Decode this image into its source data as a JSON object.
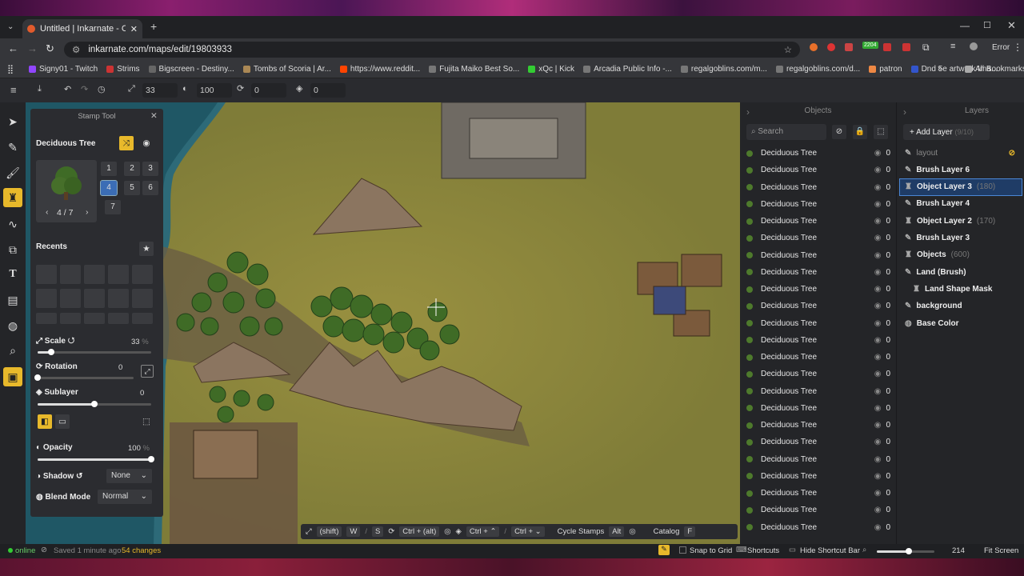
{
  "browser": {
    "tab_title": "Untitled | Inkarnate - Create Fa",
    "url": "inkarnate.com/maps/edit/19803933",
    "error_label": "Error",
    "bookmarks": [
      "Signy01 - Twitch",
      "Strims",
      "Bigscreen - Destiny...",
      "Tombs of Scoria | Ar...",
      "https://www.reddit...",
      "Fujita Maiko Best So...",
      "xQc | Kick",
      "Arcadia Public Info -...",
      "regalgoblins.com/m...",
      "regalgoblins.com/d...",
      "patron",
      "Dnd 5e artwork Ima..."
    ],
    "all_bookmarks": "All Bookmarks",
    "ext_badge": "2204"
  },
  "toolbar": {
    "scale_value": "33",
    "opacity_value": "100",
    "rotation_value": "0",
    "layer_value": "0"
  },
  "stamp": {
    "title": "Stamp Tool",
    "asset_name": "Deciduous Tree",
    "variant_counter": "4 / 7",
    "variants": [
      "1",
      "2",
      "3",
      "4",
      "5",
      "6",
      "7"
    ],
    "selected_variant": "4",
    "recents_label": "Recents",
    "scale_label": "Scale",
    "scale_value": "33",
    "scale_unit": "%",
    "scale_level": 0.12,
    "rotation_label": "Rotation",
    "rotation_value": "0",
    "rotation_level": 0.0,
    "sublayer_label": "Sublayer",
    "sublayer_value": "0",
    "sublayer_level": 0.5,
    "opacity_label": "Opacity",
    "opacity_value": "100",
    "opacity_unit": "%",
    "opacity_level": 1.0,
    "shadow_label": "Shadow",
    "shadow_value": "None",
    "blend_label": "Blend Mode",
    "blend_value": "Normal"
  },
  "objects": {
    "header": "Objects",
    "search_placeholder": "Search",
    "item_name": "Deciduous Tree",
    "item_count": "0",
    "items": [
      "Deciduous Tree",
      "Deciduous Tree",
      "Deciduous Tree",
      "Deciduous Tree",
      "Deciduous Tree",
      "Deciduous Tree",
      "Deciduous Tree",
      "Deciduous Tree",
      "Deciduous Tree",
      "Deciduous Tree",
      "Deciduous Tree",
      "Deciduous Tree",
      "Deciduous Tree",
      "Deciduous Tree",
      "Deciduous Tree",
      "Deciduous Tree",
      "Deciduous Tree",
      "Deciduous Tree",
      "Deciduous Tree",
      "Deciduous Tree",
      "Deciduous Tree",
      "Deciduous Tree",
      "Deciduous Tree"
    ]
  },
  "layers": {
    "header": "Layers",
    "add_label": "Add Layer",
    "add_count": "(9/10)",
    "items": [
      {
        "name": "layout",
        "count": "",
        "dim": true
      },
      {
        "name": "Brush Layer 6",
        "count": ""
      },
      {
        "name": "Object Layer 3",
        "count": "(180)",
        "selected": true
      },
      {
        "name": "Brush Layer 4",
        "count": ""
      },
      {
        "name": "Object Layer 2",
        "count": "(170)"
      },
      {
        "name": "Brush Layer 3",
        "count": ""
      },
      {
        "name": "Objects",
        "count": "(600)"
      },
      {
        "name": "Land (Brush)",
        "count": ""
      },
      {
        "name": "Land Shape Mask",
        "count": "",
        "sub": true
      },
      {
        "name": "background",
        "count": ""
      },
      {
        "name": "Base Color",
        "count": ""
      }
    ]
  },
  "shortcuts": {
    "shift": "(shift)",
    "w": "W",
    "s": "S",
    "ctrl_alt": "Ctrl + (alt)",
    "ctrl_up": "Ctrl + ⌃",
    "ctrl_down": "Ctrl + ⌄",
    "cycle": "Cycle Stamps",
    "alt": "Alt",
    "catalog": "Catalog",
    "f": "F"
  },
  "status": {
    "online": "online",
    "saved": "Saved 1 minute ago",
    "changes": "54 changes",
    "snap": "Snap to Grid",
    "shortcuts": "Shortcuts",
    "hide_bar": "Hide Shortcut Bar",
    "zoom": "214",
    "zoom_level": 0.55,
    "fit": "Fit Screen"
  },
  "colors": {
    "accent": "#e8b92b",
    "selected": "#3b6db5",
    "grass": "#8d8a40"
  }
}
